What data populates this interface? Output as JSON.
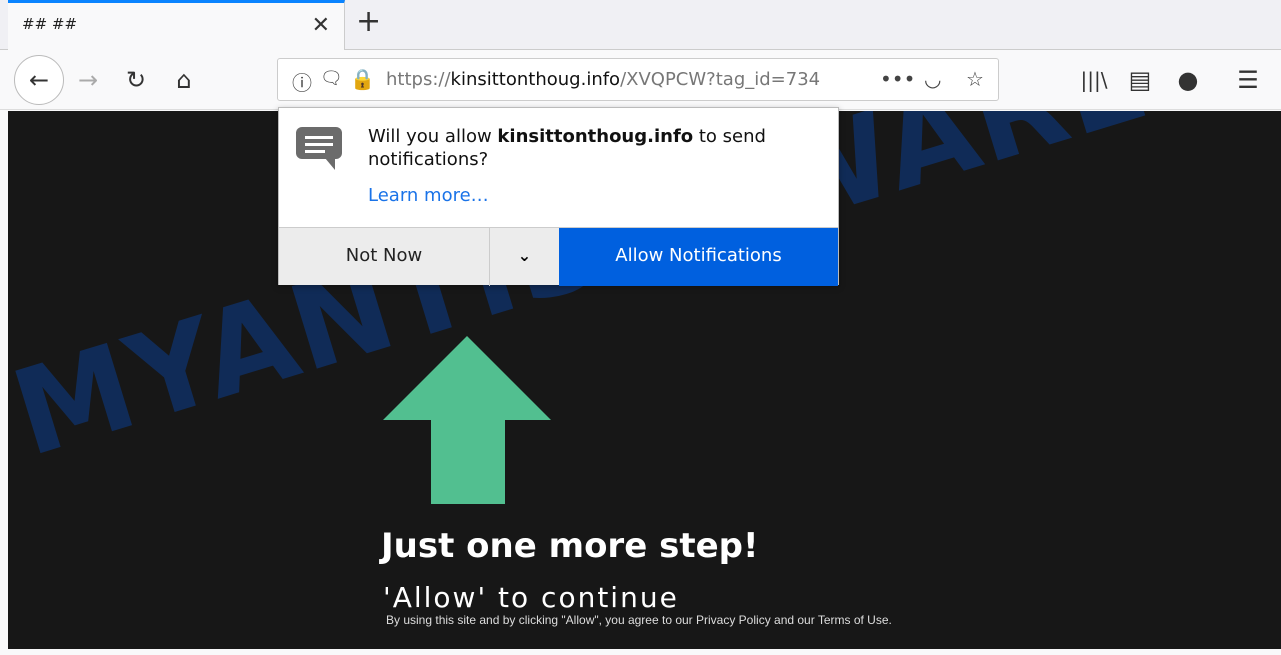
{
  "tab": {
    "title": "## ##"
  },
  "url": {
    "scheme": "https://",
    "domain": "kinsittonthoug.info",
    "path": "/XVQPCW?tag_id=734"
  },
  "popup": {
    "prefix": "Will you allow ",
    "domain": "kinsittonthoug.info",
    "suffix": " to send notifications?",
    "learn_more": "Learn more…",
    "not_now": "Not Now",
    "allow": "Allow Notifications"
  },
  "page": {
    "headline": "Just one more step!",
    "subheadline": "'Allow' to continue",
    "fine_print": "By using this site and by clicking \"Allow\", you agree to our Privacy Policy and our Terms of Use.",
    "watermark": "MYANTISPYWARE.COM"
  },
  "colors": {
    "accent": "#0060df",
    "arrow": "#52bf90",
    "lock": "#12bc00"
  }
}
